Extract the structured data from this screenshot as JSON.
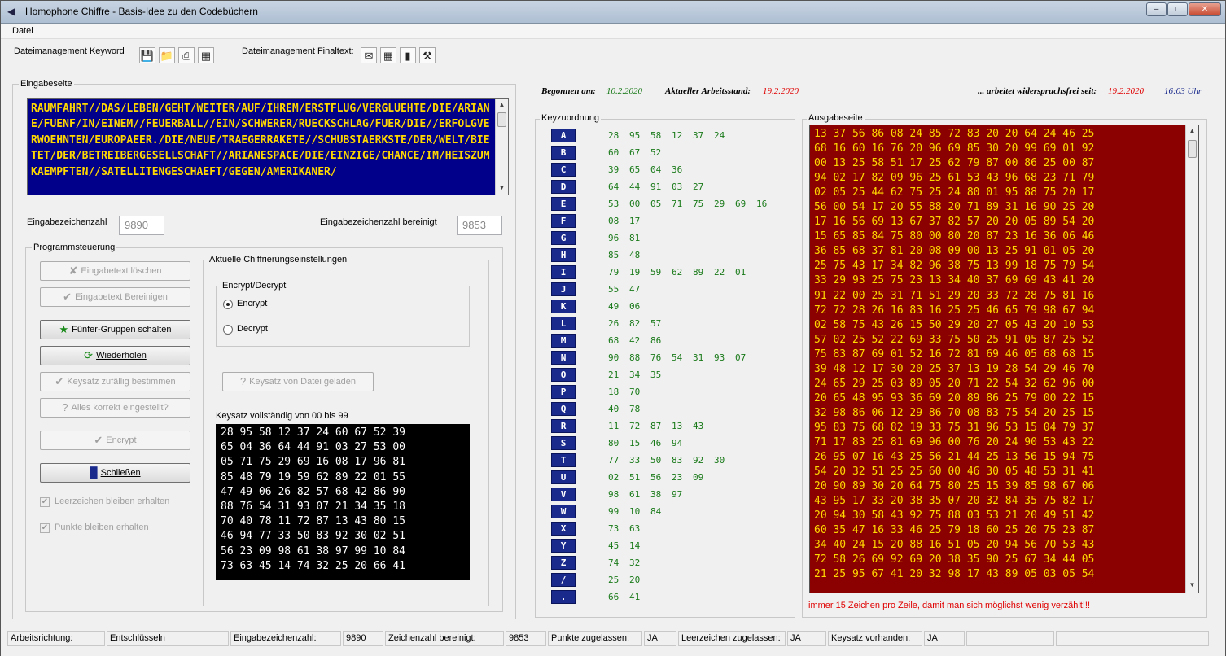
{
  "window": {
    "title": "Homophone Chiffre - Basis-Idee zu den Codebüchern",
    "controls": [
      "minimize",
      "maximize",
      "close"
    ]
  },
  "menu": {
    "items": [
      "Datei"
    ]
  },
  "toolbar": {
    "keyword_label": "Dateimanagement Keyword",
    "finaltext_label": "Dateimanagement Finaltext:",
    "keyword_icons": [
      "save-icon",
      "open-folder-icon",
      "print-icon",
      "print-preview-icon"
    ],
    "finaltext_icons": [
      "mail-icon",
      "table-icon",
      "chart-icon",
      "tools-icon"
    ]
  },
  "dates": {
    "begonnen_label": "Begonnen am:",
    "begonnen_value": "10.2.2020",
    "arbeitsstand_label": "Aktueller Arbeitsstand:",
    "arbeitsstand_value": "19.2.2020",
    "frei_label": "... arbeitet widerspruchsfrei seit:",
    "frei_value": "19.2.2020",
    "time": "16:03 Uhr"
  },
  "eingabe": {
    "legend": "Eingabeseite",
    "text": "RAUMFAHRT//DAS/LEBEN/GEHT/WEITER/AUF/IHREM/ERSTFLUG/VERGLUEHTE/DIE/ARIANE/FUENF/IN/EINEM//FEUERBALL//EIN/SCHWERER/RUECKSCHLAG/FUER/DIE//ERFOLGVERWOEHNTEN/EUROPAEER./DIE/NEUE/TRAEGERRAKETE//SCHUBSTAERKSTE/DER/WELT/BIETET/DER/BETREIBERGESELLSCHAFT//ARIANESPACE/DIE/EINZIGE/CHANCE/IM/HEISZUMKAEMPFTEN//SATELLITENGESCHAEFT/GEGEN/AMERIKANER/",
    "count_label": "Eingabezeichenzahl",
    "count_value": "9890",
    "clean_label": "Eingabezeichenzahl bereinigt",
    "clean_value": "9853"
  },
  "programm": {
    "legend": "Programmsteuerung",
    "buttons": {
      "loeschen": "Eingabetext löschen",
      "bereinigen": "Eingabetext Bereinigen",
      "fuenfer": "Fünfer-Gruppen schalten",
      "wiederholen": "Wiederholen",
      "zufall": "Keysatz zufällig bestimmen",
      "korrekt": "Alles korrekt eingestellt?",
      "encrypt": "Encrypt",
      "schliessen": "Schließen"
    },
    "checks": {
      "leerzeichen": "Leerzeichen bleiben erhalten",
      "punkte": "Punkte bleiben erhalten"
    }
  },
  "chiffrierung": {
    "legend": "Aktuelle Chiffrierungseinstellungen",
    "mode_legend": "Encrypt/Decrypt",
    "encrypt": "Encrypt",
    "decrypt": "Decrypt",
    "selected": "Encrypt",
    "file_button": "Keysatz von Datei geladen",
    "keyset_label": "Keysatz vollständig von 00 bis 99",
    "keyset_lines": [
      "28 95 58 12 37 24 60 67 52 39",
      "65 04 36 64 44 91 03 27 53 00",
      "05 71 75 29 69 16 08 17 96 81",
      "85 48 79 19 59 62 89 22 01 55",
      "47 49 06 26 82 57 68 42 86 90",
      "88 76 54 31 93 07 21 34 35 18",
      "70 40 78 11 72 87 13 43 80 15",
      "46 94 77 33 50 83 92 30 02 51",
      "56 23 09 98 61 38 97 99 10 84",
      "73 63 45 14 74 32 25 20 66 41"
    ]
  },
  "keyzuordnung": {
    "legend": "Keyzuordnung",
    "rows": [
      {
        "letter": "A",
        "codes": [
          "28",
          "95",
          "58",
          "12",
          "37",
          "24"
        ]
      },
      {
        "letter": "B",
        "codes": [
          "60",
          "67",
          "52"
        ]
      },
      {
        "letter": "C",
        "codes": [
          "39",
          "65",
          "04",
          "36"
        ]
      },
      {
        "letter": "D",
        "codes": [
          "64",
          "44",
          "91",
          "03",
          "27"
        ]
      },
      {
        "letter": "E",
        "codes": [
          "53",
          "00",
          "05",
          "71",
          "75",
          "29",
          "69",
          "16"
        ]
      },
      {
        "letter": "F",
        "codes": [
          "08",
          "17"
        ]
      },
      {
        "letter": "G",
        "codes": [
          "96",
          "81"
        ]
      },
      {
        "letter": "H",
        "codes": [
          "85",
          "48"
        ]
      },
      {
        "letter": "I",
        "codes": [
          "79",
          "19",
          "59",
          "62",
          "89",
          "22",
          "01"
        ]
      },
      {
        "letter": "J",
        "codes": [
          "55",
          "47"
        ]
      },
      {
        "letter": "K",
        "codes": [
          "49",
          "06"
        ]
      },
      {
        "letter": "L",
        "codes": [
          "26",
          "82",
          "57"
        ]
      },
      {
        "letter": "M",
        "codes": [
          "68",
          "42",
          "86"
        ]
      },
      {
        "letter": "N",
        "codes": [
          "90",
          "88",
          "76",
          "54",
          "31",
          "93",
          "07"
        ]
      },
      {
        "letter": "O",
        "codes": [
          "21",
          "34",
          "35"
        ]
      },
      {
        "letter": "P",
        "codes": [
          "18",
          "70"
        ]
      },
      {
        "letter": "Q",
        "codes": [
          "40",
          "78"
        ]
      },
      {
        "letter": "R",
        "codes": [
          "11",
          "72",
          "87",
          "13",
          "43"
        ]
      },
      {
        "letter": "S",
        "codes": [
          "80",
          "15",
          "46",
          "94"
        ]
      },
      {
        "letter": "T",
        "codes": [
          "77",
          "33",
          "50",
          "83",
          "92",
          "30"
        ]
      },
      {
        "letter": "U",
        "codes": [
          "02",
          "51",
          "56",
          "23",
          "09"
        ]
      },
      {
        "letter": "V",
        "codes": [
          "98",
          "61",
          "38",
          "97"
        ]
      },
      {
        "letter": "W",
        "codes": [
          "99",
          "10",
          "84"
        ]
      },
      {
        "letter": "X",
        "codes": [
          "73",
          "63"
        ]
      },
      {
        "letter": "Y",
        "codes": [
          "45",
          "14"
        ]
      },
      {
        "letter": "Z",
        "codes": [
          "74",
          "32"
        ]
      },
      {
        "letter": "/",
        "codes": [
          "25",
          "20"
        ]
      },
      {
        "letter": ".",
        "codes": [
          "66",
          "41"
        ]
      }
    ]
  },
  "ausgabe": {
    "legend": "Ausgabeseite",
    "note": "immer 15 Zeichen pro Zeile, damit man sich möglichst wenig verzählt!!!",
    "lines": [
      "13 37 56 86 08 24 85 72 83 20 20 64 24 46 25",
      "68 16 60 16 76 20 96 69 85 30 20 99 69 01 92",
      "00 13 25 58 51 17 25 62 79 87 00 86 25 00 87",
      "94 02 17 82 09 96 25 61 53 43 96 68 23 71 79",
      "02 05 25 44 62 75 25 24 80 01 95 88 75 20 17",
      "56 00 54 17 20 55 88 20 71 89 31 16 90 25 20",
      "17 16 56 69 13 67 37 82 57 20 20 05 89 54 20",
      "15 65 85 84 75 80 00 80 20 87 23 16 36 06 46",
      "36 85 68 37 81 20 08 09 00 13 25 91 01 05 20",
      "25 75 43 17 34 82 96 38 75 13 99 18 75 79 54",
      "33 29 93 25 75 23 13 34 40 37 69 69 43 41 20",
      "91 22 00 25 31 71 51 29 20 33 72 28 75 81 16",
      "72 72 28 26 16 83 16 25 25 46 65 79 98 67 94",
      "02 58 75 43 26 15 50 29 20 27 05 43 20 10 53",
      "57 02 25 52 22 69 33 75 50 25 91 05 87 25 52",
      "75 83 87 69 01 52 16 72 81 69 46 05 68 68 15",
      "39 48 12 17 30 20 25 37 13 19 28 54 29 46 70",
      "24 65 29 25 03 89 05 20 71 22 54 32 62 96 00",
      "20 65 48 95 93 36 69 20 89 86 25 79 00 22 15",
      "32 98 86 06 12 29 86 70 08 83 75 54 20 25 15",
      "95 83 75 68 82 19 33 75 31 96 53 15 04 79 37",
      "71 17 83 25 81 69 96 00 76 20 24 90 53 43 22",
      "26 95 07 16 43 25 56 21 44 25 13 56 15 94 75",
      "54 20 32 51 25 25 60 00 46 30 05 48 53 31 41",
      "20 90 89 30 20 64 75 80 25 15 39 85 98 67 06",
      "43 95 17 33 20 38 35 07 20 32 84 35 75 82 17",
      "20 94 30 58 43 92 75 88 03 53 21 20 49 51 42",
      "60 35 47 16 33 46 25 79 18 60 25 20 75 23 87",
      "34 40 24 15 20 88 16 51 05 20 94 56 70 53 43",
      "72 58 26 69 92 69 20 38 35 90 25 67 34 44 05",
      "21 25 95 67 41 20 32 98 17 43 89 05 03 05 54"
    ]
  },
  "status": {
    "arbeitsrichtung_label": "Arbeitsrichtung:",
    "arbeitsrichtung_value": "Entschlüsseln",
    "zeichen_label": "Eingabezeichenzahl:",
    "zeichen_value": "9890",
    "bereinigt_label": "Zeichenzahl bereinigt:",
    "bereinigt_value": "9853",
    "punkte_label": "Punkte zugelassen:",
    "punkte_value": "JA",
    "leer_label": "Leerzeichen zugelassen:",
    "leer_value": "JA",
    "keysatz_label": "Keysatz vorhanden:",
    "keysatz_value": "JA"
  },
  "colors": {
    "input_bg": "#00008b",
    "input_text": "#ffd700",
    "output_bg": "#8b0000",
    "output_text": "#ffd700",
    "key_letter_bg": "#1a2a8c",
    "key_code_text": "#1a7a1a",
    "date_green": "#1a7a1a",
    "date_red": "#e00000",
    "time_blue": "#1a2a8c"
  }
}
